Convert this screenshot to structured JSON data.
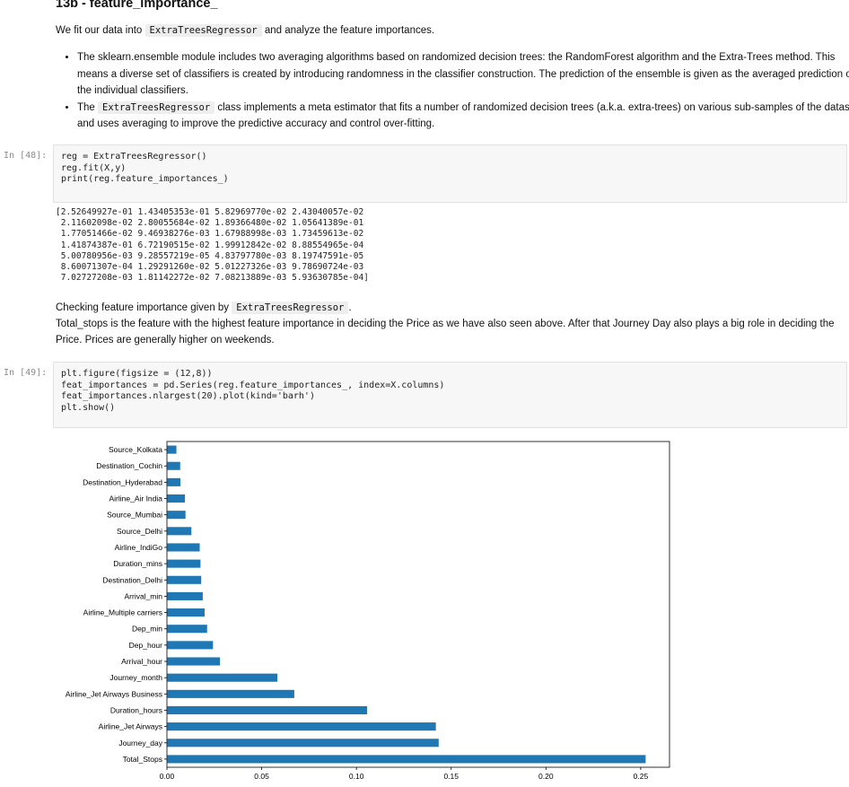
{
  "heading": "13b - feature_importance_",
  "intro": {
    "before": "We fit our data into",
    "code": "ExtraTreesRegressor",
    "after": "and analyze the feature importances."
  },
  "bullets": {
    "b1": "The sklearn.ensemble module includes two averaging algorithms based on randomized decision trees: the RandomForest algorithm and the Extra-Trees method. This means a diverse set of classifiers is created by introducing randomness in the classifier construction. The prediction of the ensemble is given as the averaged prediction of the individual classifiers.",
    "b2_before": "The",
    "b2_code": "ExtraTreesRegressor",
    "b2_after": "class implements a meta estimator that fits a number of randomized decision trees (a.k.a. extra-trees) on various sub-samples of the dataset and uses averaging to improve the predictive accuracy and control over-fitting."
  },
  "cell48": {
    "prompt": "In [48]:",
    "line1_a": "reg = ExtraTreesRegressor()",
    "line2": "reg.fit(X,y)",
    "line3": "print(reg.feature_importances_)"
  },
  "output48": "[2.52649927e-01 1.43405353e-01 5.82969770e-02 2.43040057e-02\n 2.11602098e-02 2.80055684e-02 1.89366480e-02 1.05641389e-01\n 1.77051466e-02 9.46938276e-03 1.67988998e-03 1.73459613e-02\n 1.41874387e-01 6.72190515e-02 1.99912842e-02 8.88554965e-04\n 5.00780956e-03 9.28557219e-05 4.83797780e-03 8.19747591e-05\n 8.60071307e-04 1.29291260e-02 5.01227326e-03 9.78690724e-03\n 7.02727208e-03 1.81142272e-02 7.08213889e-03 5.93630785e-04]",
  "para2": {
    "before": "Checking feature importance given by",
    "code": "ExtraTreesRegressor",
    "after": ".",
    "line2": "Total_stops is the feature with the highest feature importance in deciding the Price as we have also seen above. After that Journey Day also plays a big role in deciding the Price. Prices are generally higher on weekends."
  },
  "cell49": {
    "prompt": "In [49]:",
    "line1": "plt.figure(figsize = (12,8))",
    "line2": "feat_importances = pd.Series(reg.feature_importances_, index=X.columns)",
    "line3": "feat_importances.nlargest(20).plot(kind='barh')",
    "line4": "plt.show()"
  },
  "chart_data": {
    "type": "bar",
    "orientation": "horizontal",
    "categories": [
      "Total_Stops",
      "Journey_day",
      "Airline_Jet Airways",
      "Duration_hours",
      "Airline_Jet Airways Business",
      "Journey_month",
      "Arrival_hour",
      "Dep_hour",
      "Dep_min",
      "Airline_Multiple carriers",
      "Arrival_min",
      "Destination_Delhi",
      "Duration_mins",
      "Airline_IndiGo",
      "Source_Delhi",
      "Source_Mumbai",
      "Airline_Air India",
      "Destination_Hyderabad",
      "Destination_Cochin",
      "Source_Kolkata"
    ],
    "values": [
      0.2526,
      0.1434,
      0.1419,
      0.1056,
      0.0672,
      0.0583,
      0.028,
      0.0243,
      0.0212,
      0.0199,
      0.0189,
      0.0181,
      0.0177,
      0.0173,
      0.0129,
      0.0098,
      0.0095,
      0.0071,
      0.007,
      0.005
    ],
    "xticks": [
      "0.00",
      "0.05",
      "0.10",
      "0.15",
      "0.20",
      "0.25"
    ],
    "xlim": [
      0,
      0.2652
    ],
    "bar_color": "#1f77b4"
  }
}
